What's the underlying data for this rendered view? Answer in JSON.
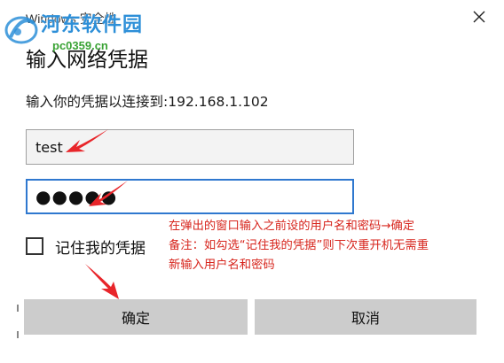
{
  "window": {
    "title": "Windows 安全性",
    "close_icon": "close-icon"
  },
  "watermark": {
    "name": "河东软件园",
    "url": "pc0359.cn"
  },
  "dialog": {
    "heading": "输入网络凭据",
    "subtitle": "输入你的凭据以连接到:192.168.1.102"
  },
  "form": {
    "username_value": "test",
    "password_value": "●●●●●",
    "remember_label": "记住我的凭据",
    "remember_checked": false
  },
  "buttons": {
    "ok_label": "确定",
    "cancel_label": "取消"
  },
  "annotation": {
    "line1": "在弹出的窗口输入之前设的用户名和密码→确定",
    "line2": "备注：如勾选“记住我的凭据”则下次重开机无需重",
    "line3": "新输入用户名和密码",
    "color": "#d7261e"
  },
  "colors": {
    "focus_border": "#2f78cf",
    "button_bg": "#cccccc",
    "annotation_arrow": "#e8252a"
  }
}
